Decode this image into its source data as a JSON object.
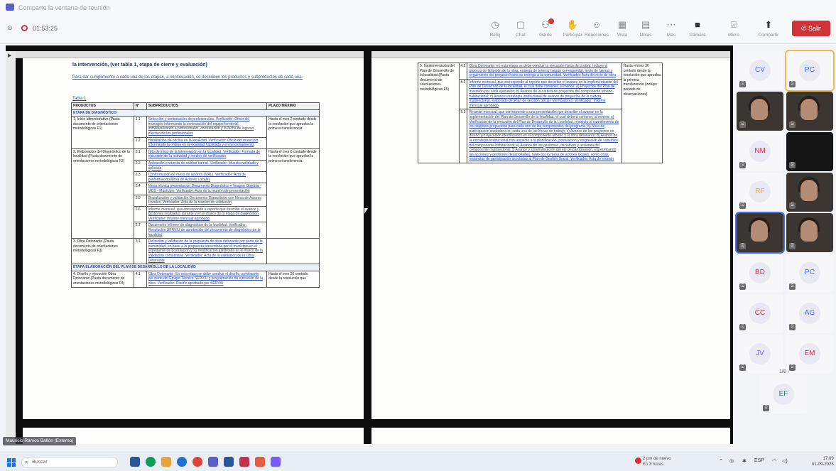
{
  "window": {
    "title": "Comparte la ventana de reunión"
  },
  "meeting": {
    "elapsed": "01:53:25",
    "toolbar": [
      {
        "icon": "clock-icon",
        "label": "Reloj"
      },
      {
        "icon": "chat-icon",
        "label": "Chat"
      },
      {
        "icon": "people-icon",
        "label": "Gente"
      },
      {
        "icon": "hand-icon",
        "label": "Participar"
      },
      {
        "icon": "smile-icon",
        "label": "Reacciones"
      },
      {
        "icon": "view-icon",
        "label": "Vista"
      },
      {
        "icon": "notes-icon",
        "label": "Notas"
      },
      {
        "icon": "more-icon",
        "label": "Más"
      },
      {
        "icon": "camera-icon",
        "label": "Cámara"
      },
      {
        "icon": "mic-icon",
        "label": "Micro"
      },
      {
        "icon": "share-icon",
        "label": "Compartir"
      }
    ],
    "leave_label": "Salir"
  },
  "document": {
    "heading": "la intervención, (ver tabla 1, etapa de cierre y evaluación)",
    "intro": "Para dar cumplimiento a cada una de las etapas, a continuación, se describen los productos y subproductos de cada una:",
    "table_title": "Tabla 1",
    "columns": [
      "PRODUCTOS",
      "N°",
      "SUBPRODUCTOS",
      "PLAZO MÁXIMO"
    ],
    "stage1": "ETAPA DE DIAGNÓSTICO",
    "rows": [
      {
        "product": "1. Inicio administrativo (Pauta documento de orientaciones metodológicas F1)",
        "n": "1.1",
        "sub": "Selección y contratación de profesionales. Verificador: Oficio del municipio informando la contratación del equipo territorial, individualizando a profesionales, contratación y la fecha de ingreso efectivo de los profesionales",
        "plazo": "Hasta el mes 2 contado desde la resolución que aprueba la primera transferencia"
      },
      {
        "product": "",
        "n": "1.2",
        "sub": "Habilitación de oficina en la localidad. Verificador: Oficio del municipio informando la oficina en la localidad habilitada y en funcionamiento",
        "plazo": ""
      },
      {
        "product": "2. Elaboración del Diagnóstico de la localidad (Pauta documento de orientaciones metodológicas F2)",
        "n": "2.1",
        "sub": "Hito de inicio de la intervención en la localidad. Verificador: Formato de ejecución de la actividad y medios de verificación",
        "plazo": "Hasta el mes 8 contado desde la resolución que aprueba la primera transferencia"
      },
      {
        "product": "",
        "n": "2.2",
        "sub": "Aplicación encuesta de calidad barrial. Verificador: Muestra validada y aplicada",
        "plazo": ""
      },
      {
        "product": "",
        "n": "2.3",
        "sub": "Conformación de mesa de actores (MAL). Verificador: Acta de conformación Mesa de Actores Locales",
        "plazo": ""
      },
      {
        "product": "",
        "n": "2.4",
        "sub": "Mesa técnica presentación Documento Diagnóstico e Imagen Objetivo - MDS - Municipio. Verificador: Acta de la reunión de presentación",
        "plazo": ""
      },
      {
        "product": "",
        "n": "2.5",
        "sub": "Socialización y validación Documento Diagnóstico con Mesa de Actores Locales. Verificador: Acta de la reunión de validación",
        "plazo": ""
      },
      {
        "product": "",
        "n": "2.6",
        "sub": "Informe mensual, que corresponde a reporte que describe el avance y gestiones realizadas durante y en el marco de la etapa de diagnóstico. Verificador: Informe mensual aprobado",
        "plazo": ""
      },
      {
        "product": "",
        "n": "2.7",
        "sub": "Documento informe de diagnóstico de la localidad. Verificador: Resolución SERVIU de aprobación del documento de diagnóstico de la localidad",
        "plazo": ""
      },
      {
        "product": "3. Obra Detonante (Pauta documento de orientaciones metodológicas F3)",
        "n": "3.1",
        "sub": "Definición y validación de la propuesta de obra detonante por parte de la comunidad, en base a la propuesta presentada por el municipio en el expediente de postulación y su modificación justificada en el marco de la validación comunitaria. Verificador: Acta de la validación de la Obra Detonante",
        "plazo": ""
      }
    ],
    "stage2": "ETAPA ELABORACIÓN DEL PLAN DE DESARROLLO DE LA LOCALIDAD",
    "row4": {
      "product": "4. Diseño y ejecución Obra Detonante (Pauta documento de orientaciones metodológicas F4)",
      "n": "4.1",
      "sub": "Obra Detonante: En esta etapa se debe concluir el diseño, aprobación por parte del Equipo Técnico SERVIU y programación de ejecución de la obra. Verificador: Diseño aprobado por SERVIU",
      "plazo": "Hasta el mes 20 contado desde la resolución que"
    },
    "page2": {
      "rows": [
        {
          "product": "5. Implementación del Plan de Desarrollo de la localidad (Pauta documento de orientaciones metodológicas F5)",
          "n": "4.2",
          "sub": "Obra Detonante: en esta etapa se debe concluir la ejecución física de la obra. Incluye el proceso de licitación de la obra, entrega de terreno (según corresponda), inicio de faenas y seguimiento del proyecto hasta su entrega a la comunidad. Verificador: Acta de inicio de obra",
          "plazo": "Hasta el mes 36 contado desde la resolución que aprueba la primera transferencia (incluye período de observaciones)"
        },
        {
          "product": "",
          "n": "5.2",
          "sub": "Informe mensual, que corresponde al reporte que describe el avance en la implementación del Plan de Desarrollo de la localidad, el cual debe contener, al menos: a) Proyectos del Plan de Inversión por cada ejecución; b) Avance de la cartera de proyectos del componente urbano-habitacional; c) Avance estrategia institucional de avance de proyectos de la cartera multisectorial, elaborado del Plan de Gestión Social. Verificadores: Verificador: Informe mensual aprobado",
          "plazo": ""
        },
        {
          "product": "",
          "n": "5.3",
          "sub": "Reunión mensual, que corresponde a una presentación que describe el avance en la implementación del Plan de Desarrollo de la localidad, el cual deberá contener, al menos: a) Verificación de la ejecución del Plan de Desarrollo de la Localidad, respecto al cumplimiento de los objetivos propuestos para cada uno de los componentes del programa; b) Nivel de participación ciudadana en cada una de las líneas de trabajo; c) Avance de los proyectos en diseño y/o ejecución identificados en el componente urbano y la obra detonante; d) Avance de la estrategia institucional con respecto a la planificación, postulación y asignación de subsidios del componente habitacional; e) Avance de las gestiones, iniciativas y acciones del componente multisectorial; f) Avance y sistematización del eje de participación, especificando las acciones y gestiones desarrolladas, tanto por la mesa de actores locales, como otras instancias de participación asociadas al Plan de Gestión Social. Verificador: Acta de reunión",
          "plazo": ""
        }
      ]
    }
  },
  "participants": [
    {
      "initials": "CV",
      "kind": "avatar",
      "color": "#4f6bed"
    },
    {
      "initials": "PC",
      "kind": "avatar",
      "color": "#4f6bed",
      "active": true
    },
    {
      "initials": "",
      "kind": "video"
    },
    {
      "initials": "",
      "kind": "video"
    },
    {
      "initials": "NM",
      "kind": "avatar",
      "color": "#c4314b"
    },
    {
      "initials": "",
      "kind": "dark"
    },
    {
      "initials": "RF",
      "kind": "avatar",
      "color": "#e6a23c"
    },
    {
      "initials": "",
      "kind": "video"
    },
    {
      "initials": "",
      "kind": "video",
      "selected": true
    },
    {
      "initials": "",
      "kind": "video"
    },
    {
      "initials": "BD",
      "kind": "avatar",
      "color": "#c4314b"
    },
    {
      "initials": "PC",
      "kind": "avatar",
      "color": "#4f6bed"
    },
    {
      "initials": "CC",
      "kind": "avatar",
      "color": "#c4314b"
    },
    {
      "initials": "AG",
      "kind": "avatar",
      "color": "#4f6bed"
    },
    {
      "initials": "JV",
      "kind": "avatar",
      "color": "#7a5af8"
    },
    {
      "initials": "EM",
      "kind": "avatar",
      "color": "#c4314b"
    },
    {
      "initials": "EF",
      "kind": "avatar",
      "color": "#2e7d6b"
    }
  ],
  "pager": "1/6  ›",
  "presenter": "Mauricio Ramos Ballón (Externo)",
  "taskbar": {
    "search_placeholder": "Buscar",
    "notification_title": "2 pm de nuevo",
    "notification_sub": "En 3 horas",
    "language": "ESP",
    "time": "17:09",
    "date": "01-09-2025"
  }
}
